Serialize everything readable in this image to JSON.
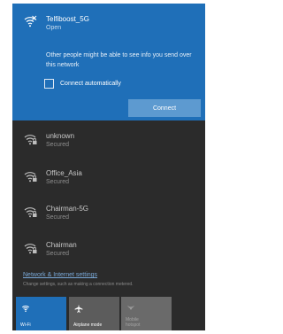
{
  "selected_network": {
    "name": "Telfiboost_5G",
    "status": "Open",
    "warning": "Other people might be able to see info you send over this network",
    "auto_connect_label": "Connect automatically",
    "auto_connect_checked": false,
    "connect_label": "Connect",
    "icon": "wifi-unsecured-icon"
  },
  "networks": [
    {
      "name": "unknown",
      "status": "Secured",
      "icon": "wifi-secured-icon"
    },
    {
      "name": "Office_Asia",
      "status": "Secured",
      "icon": "wifi-secured-icon"
    },
    {
      "name": "Chairman-5G",
      "status": "Secured",
      "icon": "wifi-secured-icon"
    },
    {
      "name": "Chairman",
      "status": "Secured",
      "icon": "wifi-secured-icon"
    }
  ],
  "settings": {
    "link_label": "Network & Internet settings",
    "description": "Change settings, such as making a connection metered."
  },
  "quick_actions": [
    {
      "label": "Wi-Fi",
      "state": "on",
      "icon": "wifi-icon"
    },
    {
      "label": "Airplane mode",
      "state": "off",
      "icon": "airplane-icon"
    },
    {
      "label": "Mobile hotspot",
      "state": "disabled",
      "icon": "hotspot-icon"
    }
  ],
  "colors": {
    "accent": "#1f6fb8",
    "flyout_background": "#2b2b2b",
    "link": "#7aa9d8"
  }
}
